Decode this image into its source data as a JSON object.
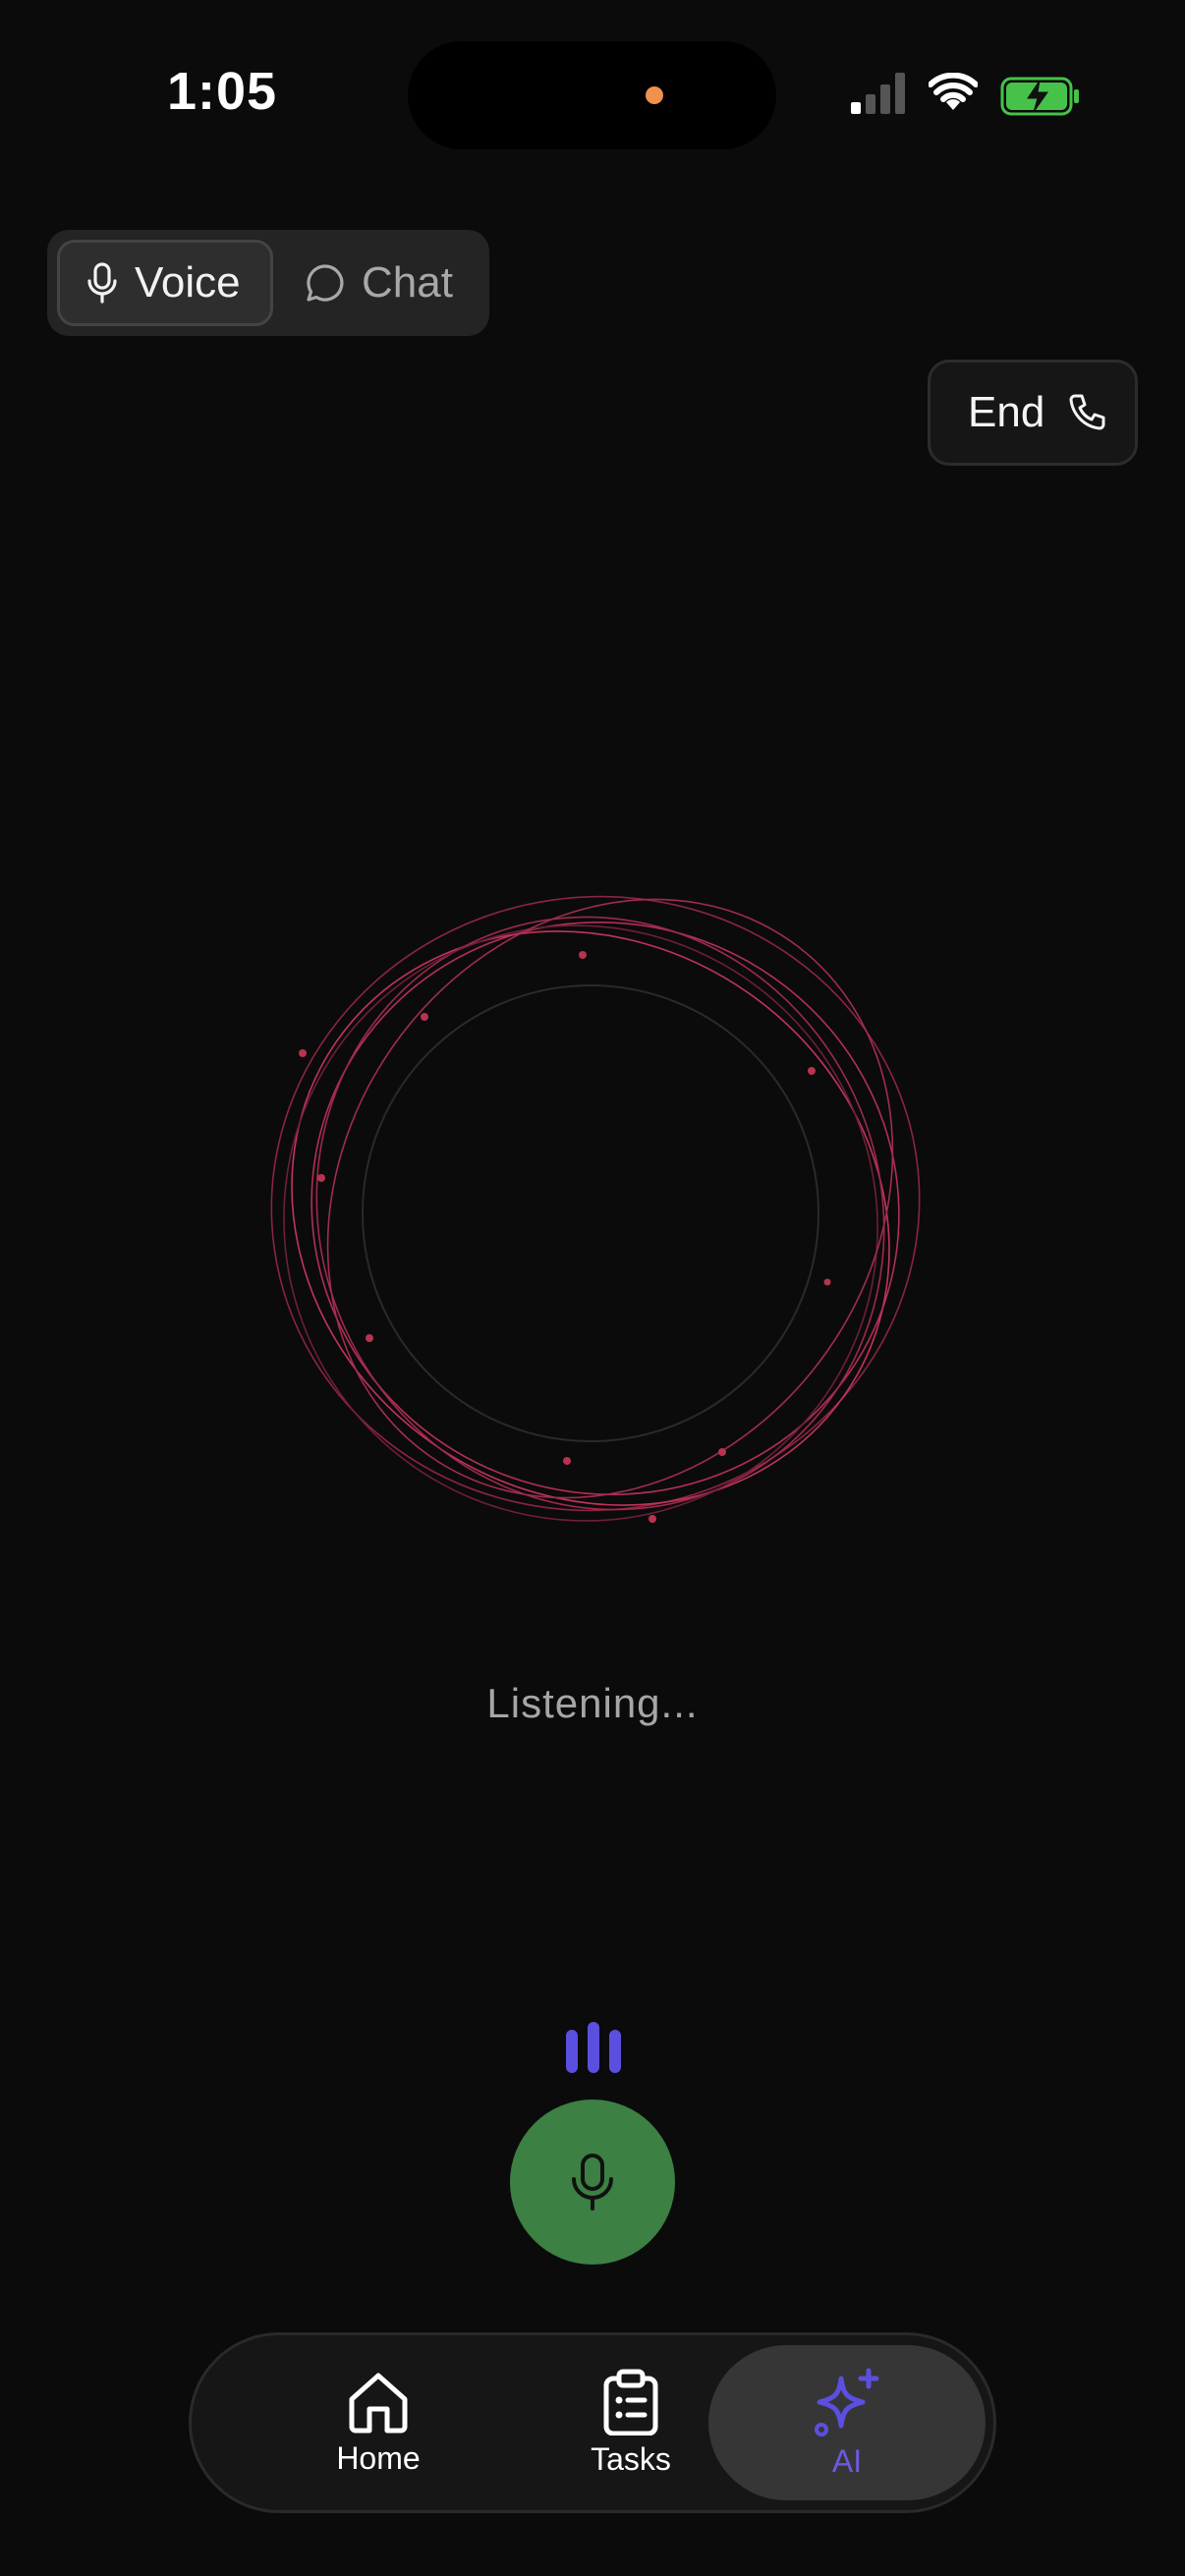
{
  "status_bar": {
    "time": "1:05"
  },
  "mode_toggle": {
    "voice_label": "Voice",
    "chat_label": "Chat",
    "selected": "Voice"
  },
  "end_button": {
    "label": "End"
  },
  "orb": {
    "state_text": "Listening..."
  },
  "nav": {
    "items": [
      {
        "label": "Home",
        "icon": "home-icon"
      },
      {
        "label": "Tasks",
        "icon": "clipboard-icon"
      },
      {
        "label": "AI",
        "icon": "sparkle-icon"
      }
    ],
    "selected": "AI"
  },
  "colors": {
    "background": "#0b0b0b",
    "accent": "#5b4fe0",
    "mic_button": "#3c8043",
    "orb_stroke": "#c2345c",
    "battery": "#46c24a"
  }
}
